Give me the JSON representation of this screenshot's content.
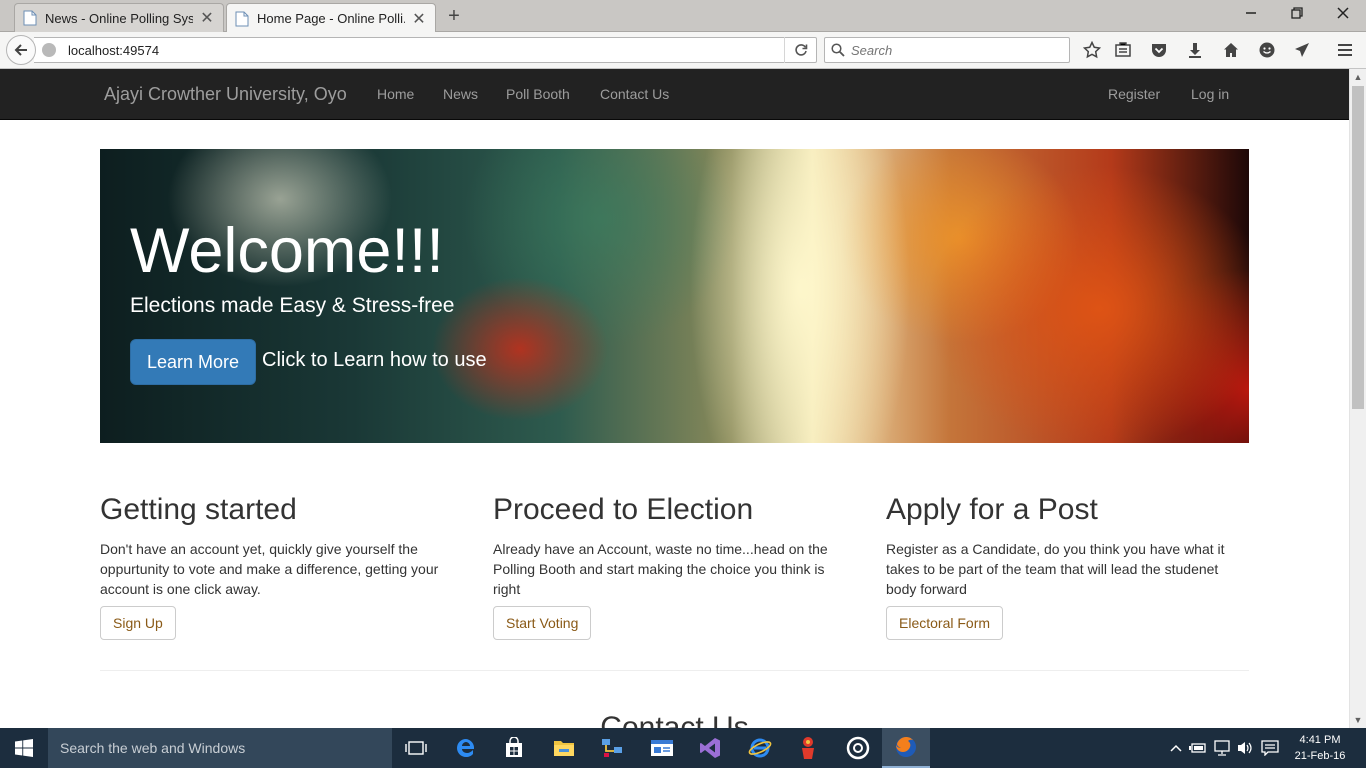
{
  "browser": {
    "tabs": [
      {
        "title": "News - Online Polling Syst...",
        "active": false
      },
      {
        "title": "Home Page - Online Polli...",
        "active": true
      }
    ],
    "url": "localhost:49574",
    "search_placeholder": "Search"
  },
  "site": {
    "brand": "Ajayi Crowther University, Oyo",
    "nav": {
      "home": "Home",
      "news": "News",
      "poll_booth": "Poll Booth",
      "contact": "Contact Us",
      "register": "Register",
      "login": "Log in"
    },
    "jumbotron": {
      "title": "Welcome!!!",
      "lead": "Elections made Easy & Stress-free",
      "button": "Learn More",
      "note": "Click to Learn how to use"
    },
    "columns": [
      {
        "heading": "Getting started",
        "text": "Don't have an account yet, quickly give yourself the oppurtunity to vote and make a difference, getting your account is one click away.",
        "button": "Sign Up"
      },
      {
        "heading": "Proceed to Election",
        "text": "Already have an Account, waste no time...head on the Polling Booth and start making the choice you think is right",
        "button": "Start Voting"
      },
      {
        "heading": "Apply for a Post",
        "text": "Register as a Candidate, do you think you have what it takes to be part of the team that will lead the studenet body forward",
        "button": "Electoral Form"
      }
    ],
    "section_title": "Contact Us"
  },
  "taskbar": {
    "search_placeholder": "Search the web and Windows",
    "time": "4:41 PM",
    "date": "21-Feb-16"
  },
  "colors": {
    "navbar": "#222222",
    "nav_text": "#9d9d9d",
    "primary_button": "#337ab7",
    "default_button_text": "#8a5a17",
    "taskbar": "#1c2d3e"
  }
}
